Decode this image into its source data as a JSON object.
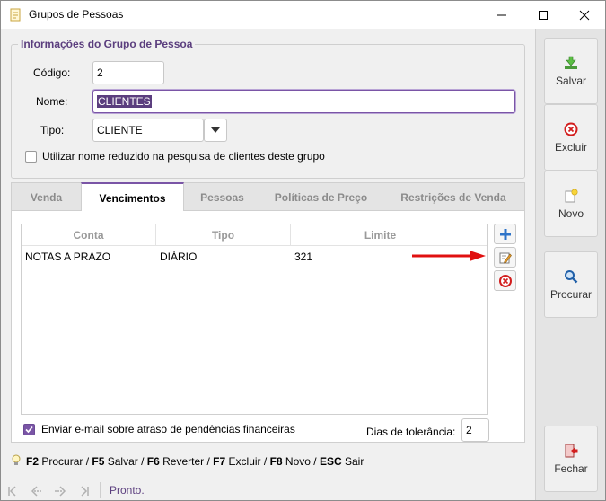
{
  "window": {
    "title": "Grupos de Pessoas",
    "icon": "document-icon"
  },
  "group_info": {
    "legend": "Informações do Grupo de Pessoa",
    "codigo_label": "Código:",
    "codigo_value": "2",
    "nome_label": "Nome:",
    "nome_value": "CLIENTES",
    "tipo_label": "Tipo:",
    "tipo_value": "CLIENTE",
    "reduced_name_checkbox": {
      "label": "Utilizar nome reduzido na pesquisa de clientes deste grupo",
      "checked": false
    }
  },
  "tabs": [
    {
      "label": "Venda",
      "active": false
    },
    {
      "label": "Vencimentos",
      "active": true
    },
    {
      "label": "Pessoas",
      "active": false
    },
    {
      "label": "Políticas de Preço",
      "active": false
    },
    {
      "label": "Restrições de Venda",
      "active": false
    }
  ],
  "vencimentos_grid": {
    "columns": [
      "Conta",
      "Tipo",
      "Limite"
    ],
    "rows": [
      {
        "conta": "NOTAS A PRAZO",
        "tipo": "DIÁRIO",
        "limite": "321"
      }
    ]
  },
  "grid_actions": {
    "add_icon": "plus-icon",
    "edit_icon": "edit-icon",
    "remove_icon": "remove-icon"
  },
  "email_checkbox": {
    "label": "Enviar e-mail sobre atraso de pendências financeiras",
    "checked": true
  },
  "tolerancia": {
    "label": "Dias de tolerância:",
    "value": "2"
  },
  "shortcuts": [
    {
      "key": "F2",
      "action": "Procurar"
    },
    {
      "key": "F5",
      "action": "Salvar"
    },
    {
      "key": "F6",
      "action": "Reverter"
    },
    {
      "key": "F7",
      "action": "Excluir"
    },
    {
      "key": "F8",
      "action": "Novo"
    },
    {
      "key": "ESC",
      "action": "Sair"
    }
  ],
  "status": {
    "text": "Pronto."
  },
  "actions": {
    "salvar": "Salvar",
    "excluir": "Excluir",
    "novo": "Novo",
    "procurar": "Procurar",
    "fechar": "Fechar"
  },
  "colors": {
    "accent": "#7a55a6",
    "legend": "#5b3e7e",
    "arrow": "#e01010"
  }
}
